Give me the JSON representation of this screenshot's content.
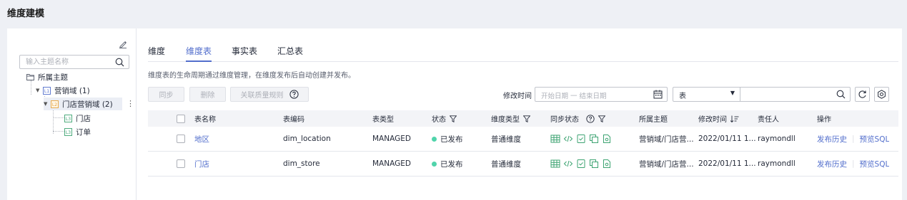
{
  "page": {
    "title": "维度建模"
  },
  "tree": {
    "search_placeholder": "输入主题名称",
    "nodes": [
      {
        "label": "所属主题",
        "tag": ""
      },
      {
        "label": "营销域 (1)",
        "tag": "L1"
      },
      {
        "label": "门店营销域 (2)",
        "tag": "L2"
      },
      {
        "label": "门店",
        "tag": "L3"
      },
      {
        "label": "订单",
        "tag": "L3"
      }
    ]
  },
  "tabs": [
    {
      "label": "维度"
    },
    {
      "label": "维度表",
      "active": true
    },
    {
      "label": "事实表"
    },
    {
      "label": "汇总表"
    }
  ],
  "hint": "维度表的生命周期通过维度管理，在维度发布后自动创建并发布。",
  "toolbar": {
    "sync_label": "同步",
    "delete_label": "删除",
    "quality_label": "关联质量规则",
    "mod_time_label": "修改时间",
    "date_range_placeholder": "开始日期 一 结束日期",
    "type_select": "表"
  },
  "table": {
    "headers": {
      "name": "表名称",
      "code": "表编码",
      "type": "表类型",
      "status": "状态",
      "dim_type": "维度类型",
      "sync_status": "同步状态",
      "topic": "所属主题",
      "mod_time": "修改时间",
      "owner": "责任人",
      "ops": "操作"
    },
    "rows": [
      {
        "name": "地区",
        "code": "dim_location",
        "type": "MANAGED",
        "status": "已发布",
        "dim_type": "普通维度",
        "topic": "营销域/门店营...",
        "mod_time": "2022/01/11 1...",
        "owner": "raymondll",
        "op1": "发布历史",
        "op2": "预览SQL"
      },
      {
        "name": "门店",
        "code": "dim_store",
        "type": "MANAGED",
        "status": "已发布",
        "dim_type": "普通维度",
        "topic": "营销域/门店营...",
        "mod_time": "2022/01/11 1...",
        "owner": "raymondll",
        "op1": "发布历史",
        "op2": "预览SQL"
      }
    ]
  },
  "colors": {
    "accent": "#526ecc",
    "published": "#50d4ab",
    "sync_green": "#3ca371",
    "tag_blue": "#526ecc",
    "tag_orange": "#e6a23c",
    "tag_green": "#3ca371"
  },
  "icons": [
    "edit-icon",
    "search-icon",
    "folder-icon",
    "more-icon",
    "help-icon",
    "calendar-icon",
    "refresh-icon",
    "settings-icon",
    "filter-icon",
    "sort-icon"
  ]
}
